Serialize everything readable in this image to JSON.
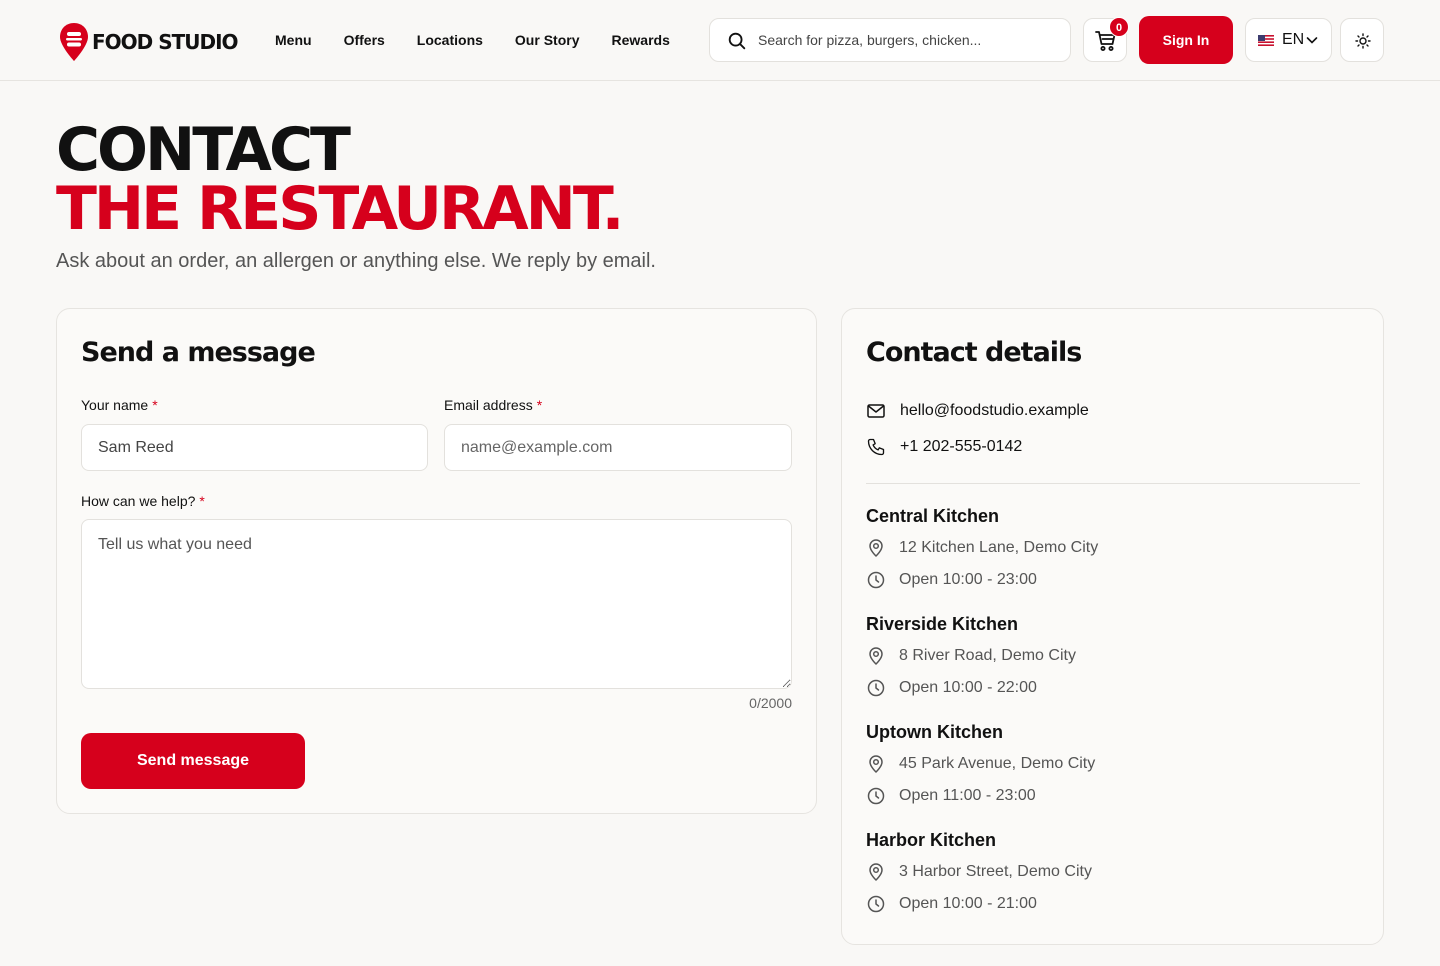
{
  "header": {
    "logo_text": "FOOD STUDIO",
    "nav": [
      "Menu",
      "Offers",
      "Locations",
      "Our Story",
      "Rewards"
    ],
    "search_placeholder": "Search for pizza, burgers, chicken...",
    "cart_count": "0",
    "sign_in": "Sign In",
    "language": "EN",
    "icons": [
      "search-icon",
      "cart-icon",
      "us-flag-icon",
      "chevron-down-icon",
      "sun-icon"
    ]
  },
  "hero": {
    "line1": "CONTACT",
    "line2": "THE RESTAURANT.",
    "subtitle": "Ask about an order, an allergen or anything else. We reply by email."
  },
  "form": {
    "title": "Send a message",
    "name_label": "Your name",
    "name_value": "Sam Reed",
    "email_label": "Email address",
    "email_placeholder": "name@example.com",
    "message_label": "How can we help?",
    "message_placeholder": "Tell us what you need",
    "required_mark": "*",
    "counter": "0/2000",
    "submit": "Send message"
  },
  "details": {
    "title": "Contact details",
    "email": "hello@foodstudio.example",
    "phone": "+1 202-555-0142",
    "locations": [
      {
        "name": "Central Kitchen",
        "address": "12 Kitchen Lane, Demo City",
        "hours": "Open 10:00 - 23:00"
      },
      {
        "name": "Riverside Kitchen",
        "address": "8 River Road, Demo City",
        "hours": "Open 10:00 - 22:00"
      },
      {
        "name": "Uptown Kitchen",
        "address": "45 Park Avenue, Demo City",
        "hours": "Open 11:00 - 23:00"
      },
      {
        "name": "Harbor Kitchen",
        "address": "3 Harbor Street, Demo City",
        "hours": "Open 10:00 - 21:00"
      }
    ]
  },
  "colors": {
    "accent": "#d6001c",
    "background": "#f9f8f6",
    "text": "#111111",
    "muted": "#555555"
  }
}
